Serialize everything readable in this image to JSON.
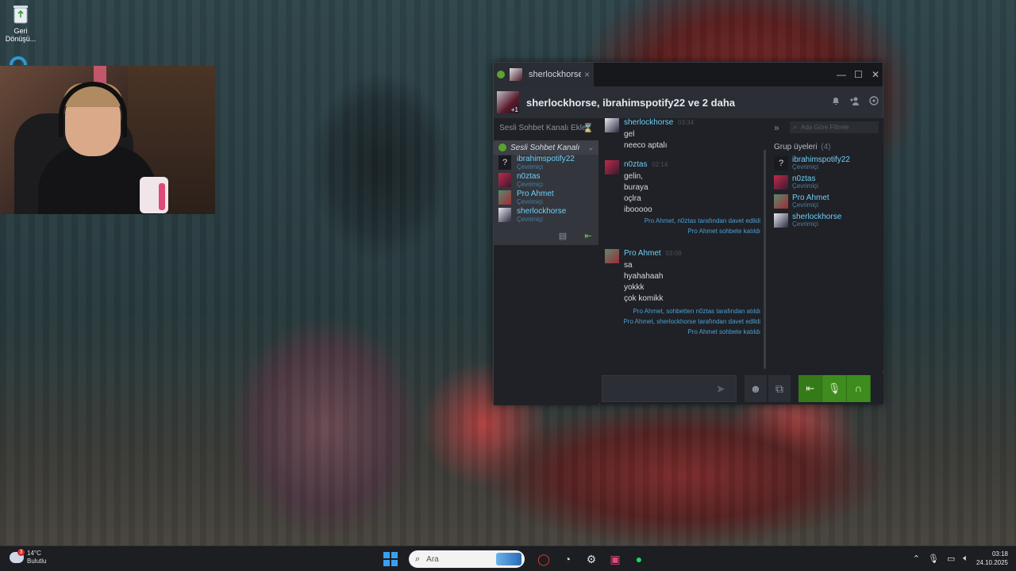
{
  "desktop": {
    "recycle_bin_label": "Geri Dönüşü..."
  },
  "chat": {
    "tab_name": "sherlockhorse",
    "tab_close": "×",
    "title": "sherlockhorse, ibrahimspotify22 ve 2 daha",
    "avatar_badge": "+1",
    "window_controls": {
      "minimize": "—",
      "maximize": "☐",
      "close": "✕"
    }
  },
  "voice": {
    "add_label": "Sesli Sohbet Kanalı Ekle",
    "channel_name": "Sesli Sohbet Kanalı",
    "members": [
      {
        "name": "ibrahimspotify22",
        "status": "Çevrimiçi",
        "avatar": "?"
      },
      {
        "name": "n0ztas",
        "status": "Çevrimiçi",
        "avatar": ""
      },
      {
        "name": "Pro Ahmet",
        "status": "Çevrimiçi",
        "avatar": ""
      },
      {
        "name": "sherlockhorse",
        "status": "Çevrimiçi",
        "avatar": ""
      }
    ]
  },
  "messages": {
    "group1": {
      "name": "sherlockhorse",
      "time": "03:34",
      "lines": [
        "gel",
        "neeco aptalı"
      ]
    },
    "group2": {
      "name": "n0ztas",
      "time": "02:14",
      "lines": [
        "gelin,",
        "buraya",
        "oçlra",
        "ibooooo"
      ],
      "system": [
        "Pro Ahmet, n0ztas tarafından davet edildi",
        "Pro Ahmet sohbete katıldı"
      ]
    },
    "group3": {
      "name": "Pro Ahmet",
      "time": "03:08",
      "lines": [
        "sa",
        "hyahahaah",
        "yokkk",
        "çok komikk"
      ],
      "system": [
        "Pro Ahmet, sohbetten n0ztas tarafından atıldı",
        "Pro Ahmet, sherlockhorse tarafından davet edildi",
        "Pro Ahmet sohbete katıldı"
      ]
    }
  },
  "members_panel": {
    "search_placeholder": "Ada Göre Filtrele",
    "group_title": "Grup üyeleri",
    "group_count": "(4)",
    "members": [
      {
        "name": "ibrahimspotify22",
        "status": "Çevrimiçi",
        "avatar": "?"
      },
      {
        "name": "n0ztas",
        "status": "Çevrimiçi",
        "avatar": ""
      },
      {
        "name": "Pro Ahmet",
        "status": "Çevrimiçi",
        "avatar": ""
      },
      {
        "name": "sherlockhorse",
        "status": "Çevrimiçi",
        "avatar": ""
      }
    ]
  },
  "taskbar": {
    "weather_temp": "14°C",
    "weather_desc": "Bulutlu",
    "weather_badge": "3",
    "search_label": "Ara",
    "time": "03:18",
    "date": "24.10.2025"
  },
  "colors": {
    "accent_blue": "#6dcff6",
    "voice_green": "#5ba32b",
    "button_green": "#3e8c1d"
  }
}
